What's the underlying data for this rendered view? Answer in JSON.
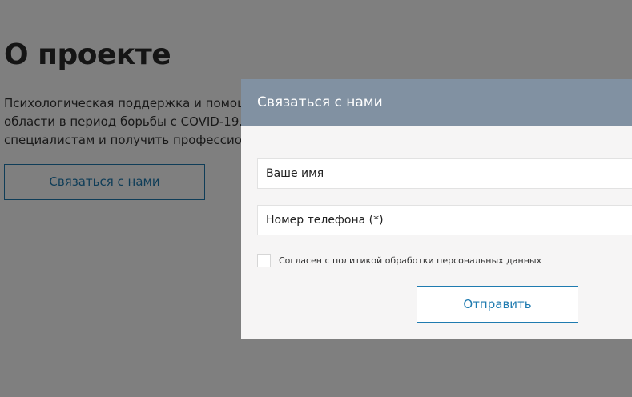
{
  "page": {
    "title": "О проекте",
    "description_lines": [
      "Психологическая поддержка и помощь",
      "области в период борьбы с COVID-19. Р",
      "специалистам и получить профессиона"
    ],
    "contact_button": "Связаться с нами"
  },
  "modal": {
    "title": "Связаться с нами",
    "name_placeholder": "Ваше имя",
    "phone_placeholder": "Номер телефона (*)",
    "consent_label": "Согласен с политикой обработки персональных данных",
    "consent_checked": false,
    "submit_label": "Отправить"
  },
  "colors": {
    "accent": "#1f7bb0",
    "modal_header": "#8191a2",
    "modal_body": "#f6f5f5",
    "overlay": "rgba(0,0,0,0.5)"
  }
}
